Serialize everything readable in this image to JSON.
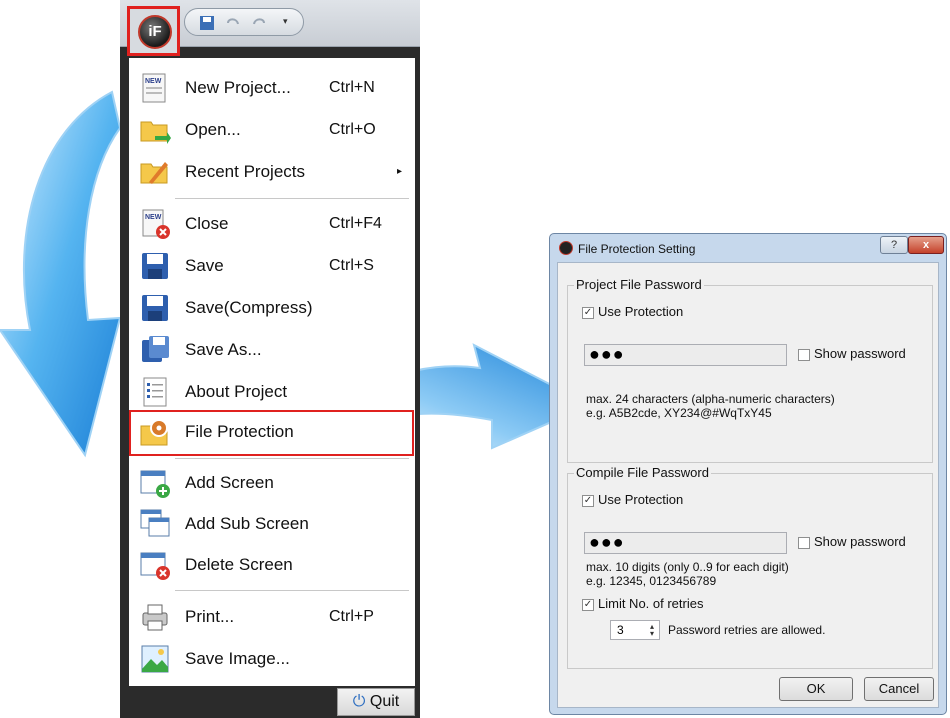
{
  "app": {
    "logo_text": "iF"
  },
  "menu": {
    "items": [
      {
        "label": "New Project...",
        "shortcut": "Ctrl+N"
      },
      {
        "label": "Open...",
        "shortcut": "Ctrl+O"
      },
      {
        "label": "Recent Projects",
        "shortcut": "",
        "submenu": "▸"
      },
      {
        "label": "Close",
        "shortcut": "Ctrl+F4"
      },
      {
        "label": "Save",
        "shortcut": "Ctrl+S"
      },
      {
        "label": "Save(Compress)",
        "shortcut": ""
      },
      {
        "label": "Save As...",
        "shortcut": ""
      },
      {
        "label": "About Project",
        "shortcut": ""
      },
      {
        "label": "File Protection",
        "shortcut": ""
      },
      {
        "label": "Add Screen",
        "shortcut": ""
      },
      {
        "label": "Add Sub Screen",
        "shortcut": ""
      },
      {
        "label": "Delete Screen",
        "shortcut": ""
      },
      {
        "label": "Print...",
        "shortcut": "Ctrl+P"
      },
      {
        "label": "Save Image...",
        "shortcut": ""
      }
    ],
    "quit_label": "Quit",
    "icons": {
      "new": "NEW"
    }
  },
  "dialog": {
    "title": "File Protection Setting",
    "help": "?",
    "close": "x",
    "project": {
      "legend": "Project File Password",
      "use_protection": "Use Protection",
      "password_mask": "●●●",
      "show_password": "Show password",
      "hint1": "max. 24 characters (alpha-numeric characters)",
      "hint2": "e.g. A5B2cde, XY234@#WqTxY45"
    },
    "compile": {
      "legend": "Compile File Password",
      "use_protection": "Use Protection",
      "password_mask": "●●●",
      "show_password": "Show password",
      "hint1": "max. 10 digits (only 0..9 for each digit)",
      "hint2": "e.g. 12345, 0123456789",
      "limit_label": "Limit No. of retries",
      "retries_value": "3",
      "retries_label": "Password retries are allowed."
    },
    "ok": "OK",
    "cancel": "Cancel"
  },
  "colors": {
    "highlight": "#e0211f",
    "arrow": "#3aa0e8",
    "dialog_frame": "#c6d8ec"
  }
}
